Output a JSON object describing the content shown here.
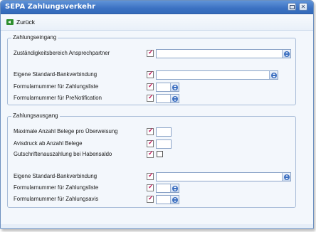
{
  "window": {
    "title": "SEPA Zahlungsverkehr"
  },
  "toolbar": {
    "back_label": "Zurück"
  },
  "eingang": {
    "title": "Zahlungseingang",
    "rows": [
      {
        "label": "Zuständigkeitsbereich Ansprechpartner",
        "value": ""
      },
      {
        "label": "Eigene Standard-Bankverbindung",
        "value": ""
      },
      {
        "label": "Formularnummer für Zahlungsliste",
        "value": ""
      },
      {
        "label": "Formularnummer für PreNotification",
        "value": ""
      }
    ]
  },
  "ausgang": {
    "title": "Zahlungsausgang",
    "rows": [
      {
        "label": "Maximale Anzahl Belege pro Überweisung",
        "value": ""
      },
      {
        "label": "Avisdruck ab Anzahl Belege",
        "value": ""
      },
      {
        "label": "Gutschriftenauszahlung bei Habensaldo",
        "checked": false
      },
      {
        "label": "Eigene Standard-Bankverbindung",
        "value": ""
      },
      {
        "label": "Formularnummer für Zahlungsliste",
        "value": ""
      },
      {
        "label": "Formularnummer für Zahlungsavis",
        "value": ""
      }
    ]
  }
}
